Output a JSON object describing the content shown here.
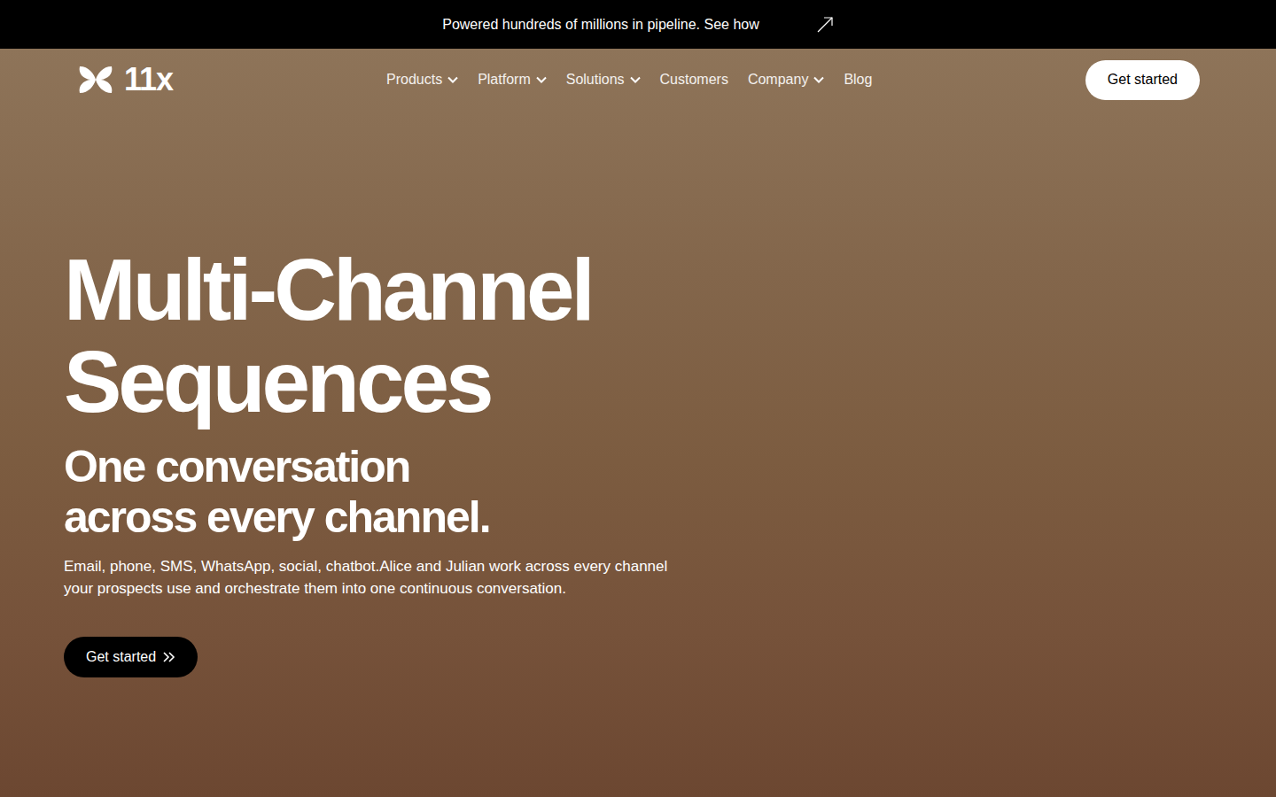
{
  "announcement": {
    "text": "Powered hundreds of millions in pipeline. See how"
  },
  "logo": {
    "text": "11x"
  },
  "nav": [
    {
      "label": "Products",
      "dropdown": true
    },
    {
      "label": "Platform",
      "dropdown": true
    },
    {
      "label": "Solutions",
      "dropdown": true
    },
    {
      "label": "Customers",
      "dropdown": false
    },
    {
      "label": "Company",
      "dropdown": true
    },
    {
      "label": "Blog",
      "dropdown": false
    }
  ],
  "header_button": "Get started",
  "hero": {
    "title_lines": [
      "Multi-Channel",
      "Sequences"
    ],
    "subtitle_lines": [
      "One conversation",
      "across every channel."
    ],
    "description": "Email, phone, SMS, WhatsApp, social, chatbot.Alice and Julian work across every channel your prospects use and orchestrate them into one continuous conversation.",
    "cta": "Get started"
  }
}
